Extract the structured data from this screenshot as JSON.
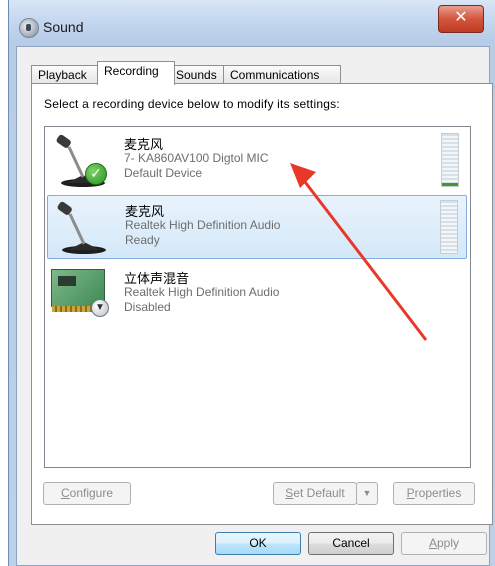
{
  "window": {
    "title": "Sound",
    "close_glyph": "✕"
  },
  "tabs": [
    {
      "label": "Playback"
    },
    {
      "label": "Recording",
      "active": true
    },
    {
      "label": "Sounds"
    },
    {
      "label": "Communications"
    }
  ],
  "instruction": "Select a recording device below to modify its settings:",
  "devices": [
    {
      "name": "麦克风",
      "description": "7- KA860AV100 Digtol MIC",
      "status": "Default Device",
      "icon": "microphone-icon",
      "badge": "default-check-icon"
    },
    {
      "name": "麦克风",
      "description": "Realtek High Definition Audio",
      "status": "Ready",
      "icon": "microphone-icon",
      "selected": true
    },
    {
      "name": "立体声混音",
      "description": "Realtek High Definition Audio",
      "status": "Disabled",
      "icon": "sound-card-icon",
      "badge": "disabled-arrow-icon"
    }
  ],
  "buttons": {
    "configure": {
      "first": "C",
      "rest": "onfigure"
    },
    "set_default": {
      "first": "S",
      "rest": "et Default"
    },
    "dropdown_glyph": "▼",
    "properties": {
      "first": "P",
      "rest": "roperties"
    },
    "ok": "OK",
    "cancel": "Cancel",
    "apply": {
      "first": "A",
      "rest": "pply"
    }
  },
  "colors": {
    "annotation_arrow": "#e8382a",
    "meter_green": "#3a9a2a"
  }
}
